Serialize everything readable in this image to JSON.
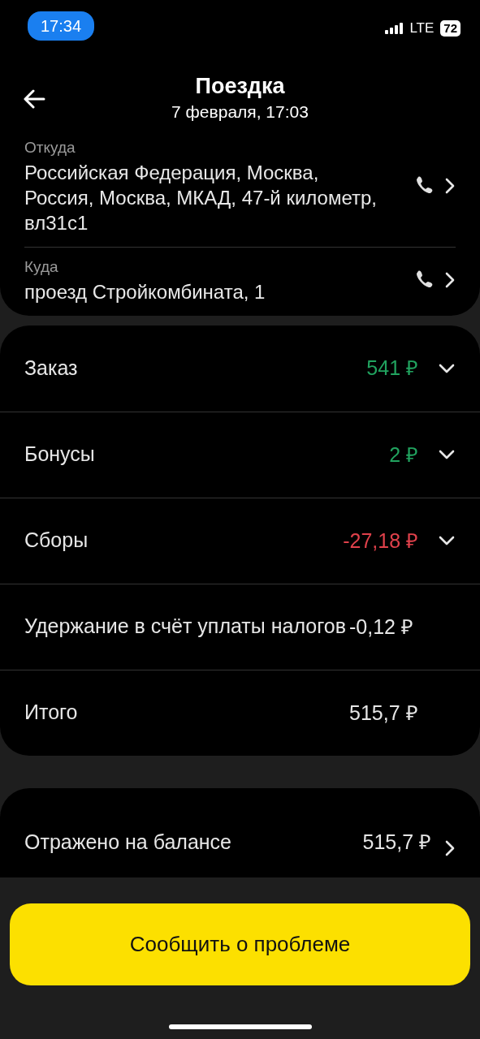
{
  "status_bar": {
    "time": "17:34",
    "network": "LTE",
    "battery": "72"
  },
  "header": {
    "title": "Поездка",
    "subtitle": "7 февраля, 17:03"
  },
  "route": [
    {
      "label": "Откуда",
      "address": "Российская Федерация, Москва, Россия, Москва, МКАД, 47-й километр, вл31с1"
    },
    {
      "label": "Куда",
      "address": "проезд Стройкомбината, 1"
    }
  ],
  "payment_rows": [
    {
      "label": "Заказ",
      "amount": "541 ₽",
      "color": "#21a35f",
      "expandable": true
    },
    {
      "label": "Бонусы",
      "amount": "2 ₽",
      "color": "#21a35f",
      "expandable": true
    },
    {
      "label": "Сборы",
      "amount": "-27,18 ₽",
      "color": "#e0414b",
      "expandable": true
    },
    {
      "label": "Удержание в счёт уплаты налогов",
      "amount": "-0,12 ₽",
      "color": "#e6e6e6",
      "expandable": false
    },
    {
      "label": "Итого",
      "amount": "515,7 ₽",
      "color": "#e6e6e6",
      "expandable": false
    }
  ],
  "balance": {
    "label": "Отражено на балансе",
    "amount": "515,7 ₽"
  },
  "report_button": {
    "label": "Сообщить о проблеме"
  }
}
